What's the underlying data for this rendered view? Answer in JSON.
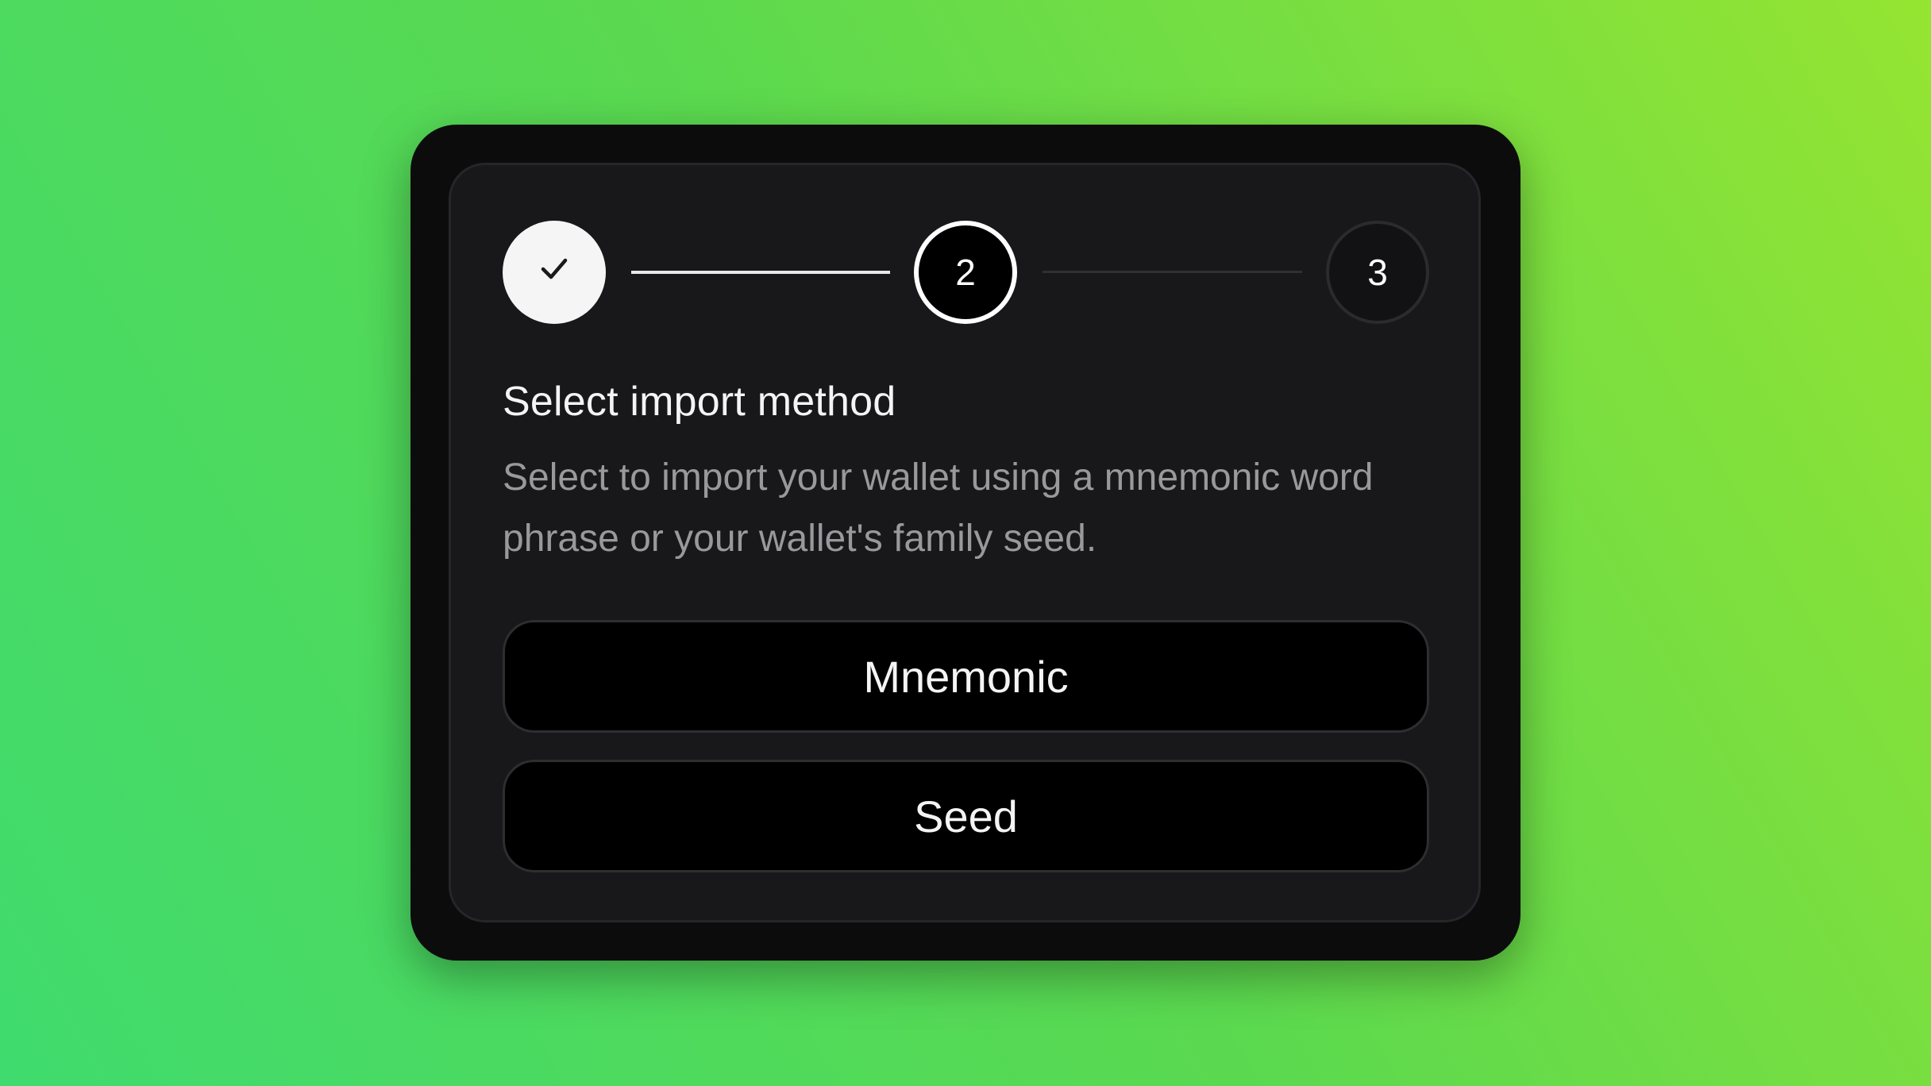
{
  "stepper": {
    "steps": [
      {
        "label": "",
        "state": "completed",
        "icon": "check-icon"
      },
      {
        "label": "2",
        "state": "current"
      },
      {
        "label": "3",
        "state": "upcoming"
      }
    ]
  },
  "content": {
    "title": "Select import method",
    "description": "Select to import your wallet using a mnemonic word phrase or your wallet's family seed."
  },
  "options": {
    "mnemonic_label": "Mnemonic",
    "seed_label": "Seed"
  },
  "colors": {
    "background_gradient_start": "#3fdb6e",
    "background_gradient_end": "#95e432",
    "card_outer": "#0c0c0d",
    "card_inner": "#18181a",
    "button_bg": "#000000",
    "text_primary": "#f4f4f5",
    "text_secondary": "#98989d"
  }
}
